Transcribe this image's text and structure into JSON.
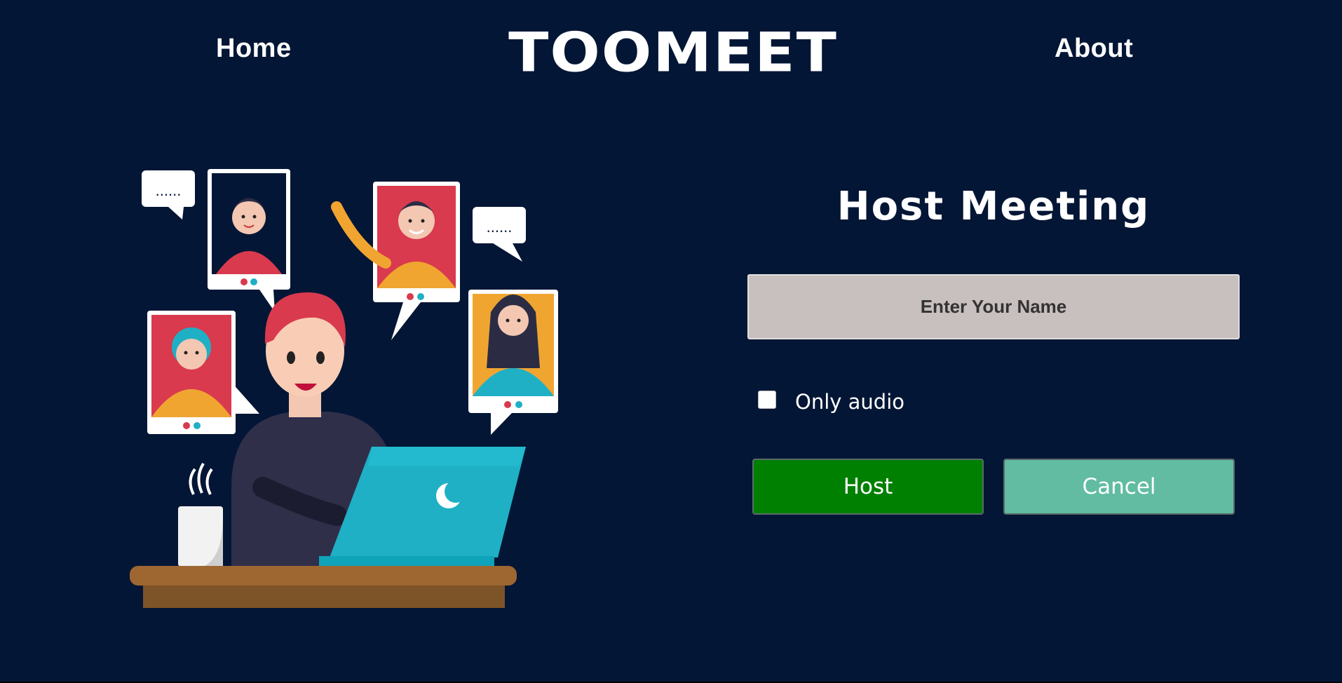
{
  "nav": {
    "home_label": "Home",
    "about_label": "About",
    "logo_text": "TOOMEET"
  },
  "form": {
    "title": "Host Meeting",
    "name_placeholder": "Enter Your Name",
    "only_audio_label": "Only audio",
    "only_audio_checked": false,
    "host_label": "Host",
    "cancel_label": "Cancel"
  },
  "colors": {
    "background": "#041635",
    "host_button": "#008000",
    "cancel_button": "#61bca1",
    "input_background": "#c8bfbf"
  }
}
